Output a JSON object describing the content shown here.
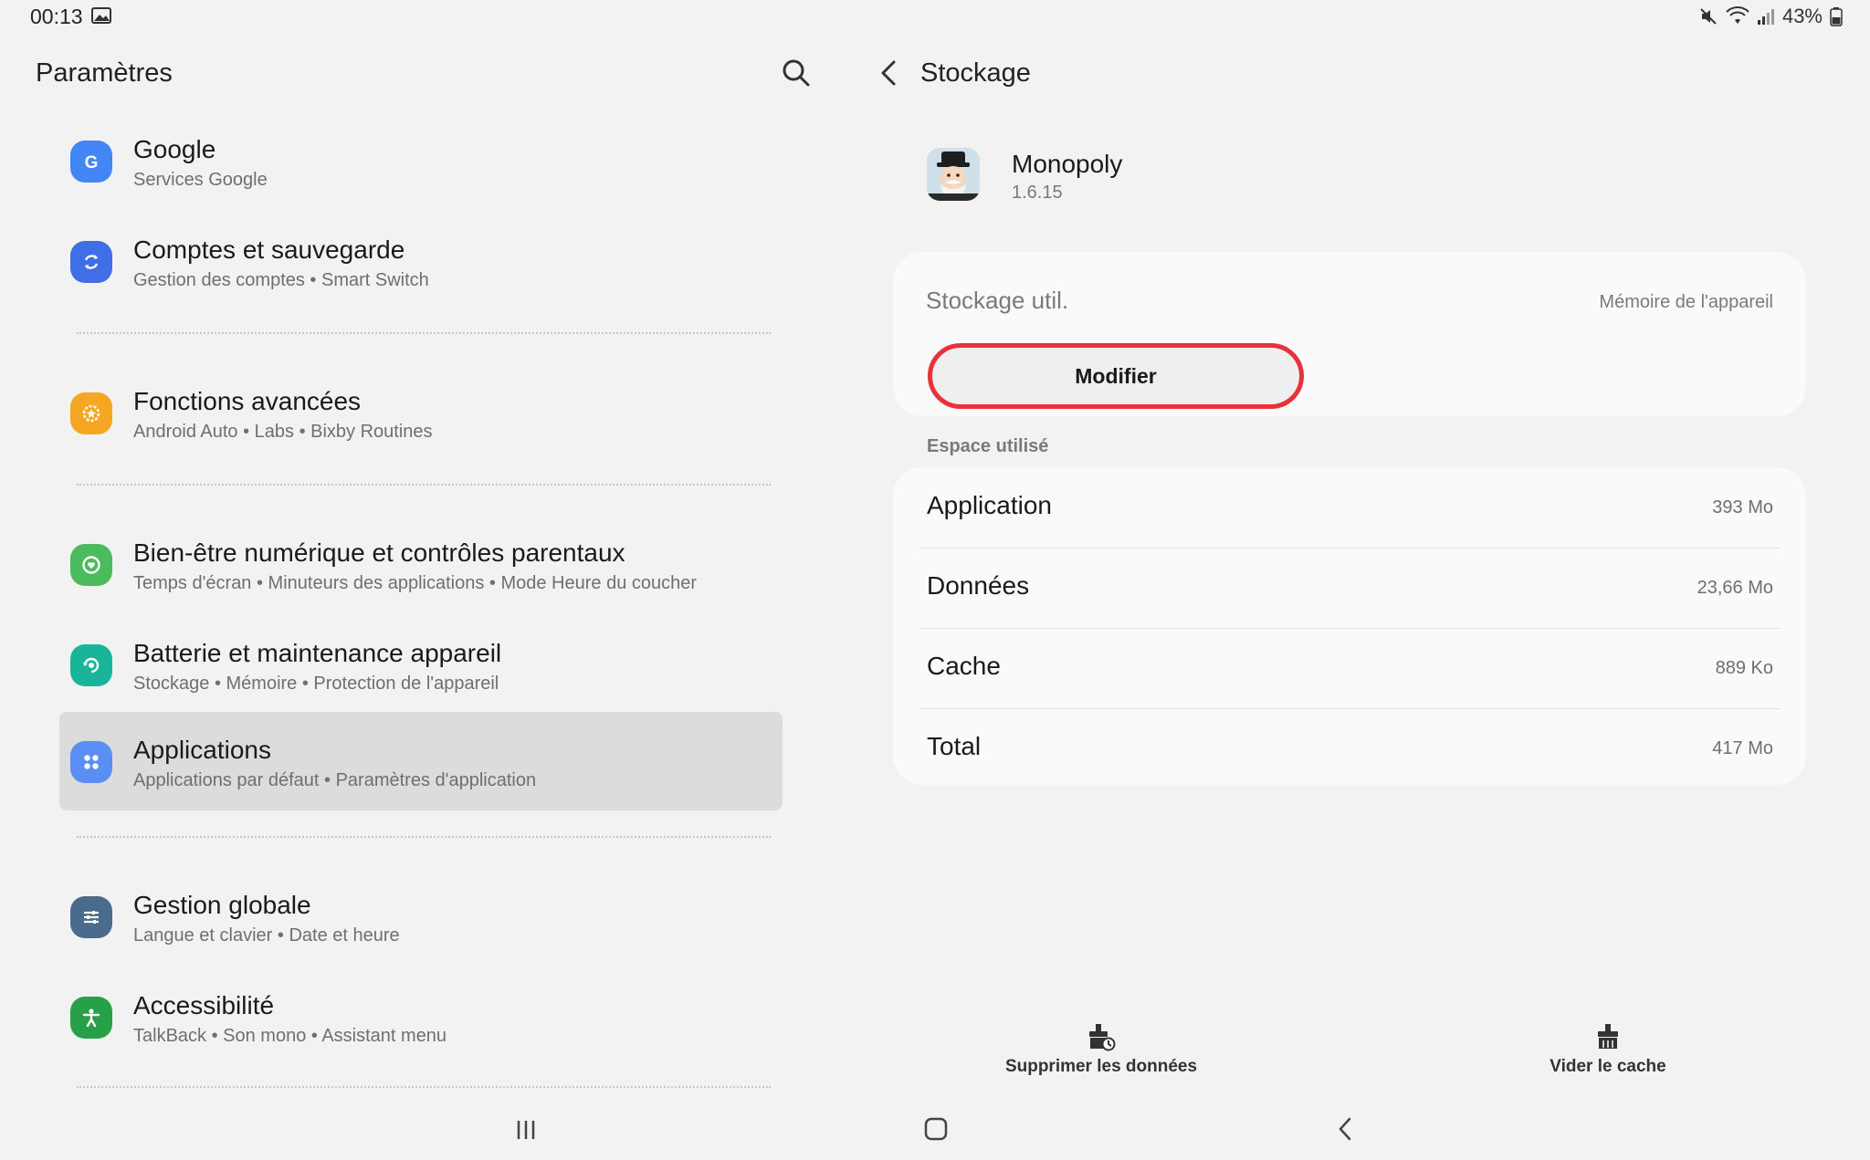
{
  "status_bar": {
    "time": "00:13",
    "battery": "43%",
    "icons": [
      "gallery-icon",
      "mute-icon",
      "wifi-icon",
      "signal-icon",
      "battery-icon"
    ]
  },
  "left_pane": {
    "title": "Paramètres",
    "items": [
      {
        "title": "Google",
        "subtitle": "Services Google",
        "icon": "google-icon",
        "color": "#4285f4"
      },
      {
        "title": "Comptes et sauvegarde",
        "subtitle": "Gestion des comptes  •  Smart Switch",
        "icon": "sync-icon",
        "color": "#3f6ee6"
      },
      {
        "title": "Fonctions avancées",
        "subtitle": "Android Auto  •  Labs  •  Bixby Routines",
        "icon": "star-gear-icon",
        "color": "#f5a623"
      },
      {
        "title": "Bien-être numérique et contrôles parentaux",
        "subtitle": "Temps d'écran  •  Minuteurs des applications  •  Mode Heure du coucher",
        "icon": "wellbeing-icon",
        "color": "#4cbb5b"
      },
      {
        "title": "Batterie et maintenance appareil",
        "subtitle": "Stockage  •  Mémoire  •  Protection de l'appareil",
        "icon": "battery-care-icon",
        "color": "#19b59a"
      },
      {
        "title": "Applications",
        "subtitle": "Applications par défaut  •  Paramètres d'application",
        "icon": "apps-icon",
        "color": "#5b8ef5"
      },
      {
        "title": "Gestion globale",
        "subtitle": "Langue et clavier  •  Date et heure",
        "icon": "sliders-icon",
        "color": "#4b6b8c"
      },
      {
        "title": "Accessibilité",
        "subtitle": "TalkBack  •  Son mono  •  Assistant menu",
        "icon": "accessibility-icon",
        "color": "#27a048"
      }
    ],
    "selected_item": "Applications"
  },
  "right_pane": {
    "title": "Stockage",
    "app": {
      "name": "Monopoly",
      "version": "1.6.15"
    },
    "storage": {
      "label": "Stockage util.",
      "location": "Mémoire de l'appareil",
      "modify_label": "Modifier"
    },
    "usage_section_label": "Espace utilisé",
    "usage": [
      {
        "name": "Application",
        "value": "393 Mo"
      },
      {
        "name": "Données",
        "value": "23,66 Mo"
      },
      {
        "name": "Cache",
        "value": "889 Ko"
      },
      {
        "name": "Total",
        "value": "417 Mo"
      }
    ],
    "actions": {
      "clear_data": "Supprimer les données",
      "clear_cache": "Vider le cache"
    }
  },
  "colors": {
    "accent_red": "#e8313a",
    "background": "#f2f2f2",
    "card": "#fafafa"
  }
}
